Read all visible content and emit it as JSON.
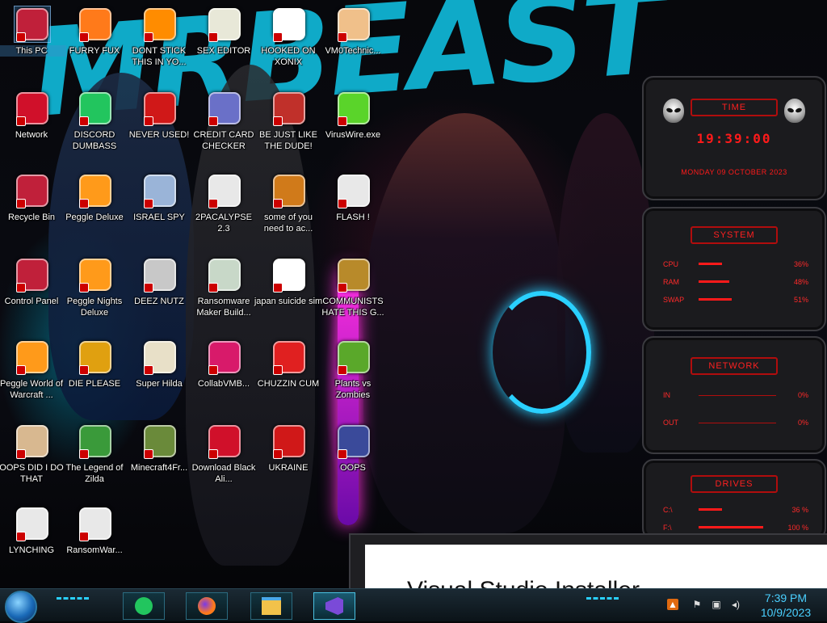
{
  "desktop": {
    "wallpaper_text": "MRBEAST",
    "icons": [
      {
        "label": "This PC",
        "icon": "computer-icon",
        "color": "#c0203a"
      },
      {
        "label": "FURRY FUX",
        "icon": "firefox-icon",
        "color": "#ff7a1a"
      },
      {
        "label": "DONT STICK THIS IN YO...",
        "icon": "vlc-cone-icon",
        "color": "#ff8c00"
      },
      {
        "label": "SEX EDITOR",
        "icon": "hxd-editor-icon",
        "color": "#e8e8d8"
      },
      {
        "label": "HOOKED ON XONIX",
        "icon": "xonix-game-icon",
        "color": "#ffffff"
      },
      {
        "label": "VM0Technic...",
        "icon": "doctor-avatar-icon",
        "color": "#f0c08a"
      },
      {
        "label": "Network",
        "icon": "network-orb-icon",
        "color": "#d0102a"
      },
      {
        "label": "DISCORD DUMBASS",
        "icon": "chat-app-icon",
        "color": "#22c55e"
      },
      {
        "label": "NEVER USED!",
        "icon": "dev-cpp-icon",
        "color": "#d01818"
      },
      {
        "label": "CREDIT CARD CHECKER",
        "icon": "credit-card-icon",
        "color": "#6a70c8"
      },
      {
        "label": "BE JUST LIKE THE DUDE!",
        "icon": "santa-bonzi-icon",
        "color": "#c0302a"
      },
      {
        "label": "VirusWire.exe",
        "icon": "lime-wire-icon",
        "color": "#5ad42a"
      },
      {
        "label": "Recycle Bin",
        "icon": "recycle-bin-icon",
        "color": "#c0203a"
      },
      {
        "label": "Peggle Deluxe",
        "icon": "peggle-icon",
        "color": "#ff9a1a"
      },
      {
        "label": "ISRAEL SPY",
        "icon": "spy-window-icon",
        "color": "#9ab4d8"
      },
      {
        "label": "2PACALYPSE 2.3",
        "icon": "terminal-icon",
        "color": "#e8e8e8"
      },
      {
        "label": "some of you need to ac...",
        "icon": "beaver-icon",
        "color": "#d07a1a"
      },
      {
        "label": "FLASH !",
        "icon": "flash-document-icon",
        "color": "#e8e8e8"
      },
      {
        "label": "Control Panel",
        "icon": "control-panel-icon",
        "color": "#c0203a"
      },
      {
        "label": "Peggle Nights Deluxe",
        "icon": "peggle-nights-icon",
        "color": "#ff9a1a"
      },
      {
        "label": "DEEZ NUTZ",
        "icon": "stacked-windows-icon",
        "color": "#c8c8c8"
      },
      {
        "label": "Ransomware Maker Build...",
        "icon": "builder-window-icon",
        "color": "#c8d8c8"
      },
      {
        "label": "japan suicide sim",
        "icon": "text-document-icon",
        "color": "#ffffff"
      },
      {
        "label": "COMMUNISTS HATE THIS G...",
        "icon": "money-bag-icon",
        "color": "#b88a2a"
      },
      {
        "label": "Peggle World of Warcraft ...",
        "icon": "peggle-wow-icon",
        "color": "#ff9a1a"
      },
      {
        "label": "DIE PLEASE",
        "icon": "de-box-icon",
        "color": "#e0a010"
      },
      {
        "label": "Super Hilda",
        "icon": "pixel-art-icon",
        "color": "#e8e0c8"
      },
      {
        "label": "CollabVMB...",
        "icon": "monitor-icon",
        "color": "#d81a6a"
      },
      {
        "label": "CHUZZIN CUM",
        "icon": "chuzzle-icon",
        "color": "#e02020"
      },
      {
        "label": "Plants vs Zombies",
        "icon": "plant-icon",
        "color": "#5aa82a"
      },
      {
        "label": "OOPS DID I DO THAT",
        "icon": "portrait-icon",
        "color": "#d8b890"
      },
      {
        "label": "The Legend of Zilda",
        "icon": "pixel-hero-icon",
        "color": "#3a9a3a"
      },
      {
        "label": "Minecraft4Fr...",
        "icon": "grass-block-icon",
        "color": "#6a8a3a"
      },
      {
        "label": "Download Black Ali...",
        "icon": "black-alien-orb-icon",
        "color": "#d0102a"
      },
      {
        "label": "UKRAINE",
        "icon": "radiation-icon",
        "color": "#d01818"
      },
      {
        "label": "OOPS",
        "icon": "book-monitor-icon",
        "color": "#3a4a9a"
      },
      {
        "label": "LYNCHING",
        "icon": "noose-icon",
        "color": "#e8e8e8"
      },
      {
        "label": "RansomWar...",
        "icon": "skull-icon",
        "color": "#e8e8e8"
      }
    ]
  },
  "gadget": {
    "time_title": "TIME",
    "time": "19:39:00",
    "date": "MONDAY 09 OCTOBER 2023",
    "system_title": "SYSTEM",
    "system_rows": [
      {
        "label": "CPU",
        "value": "36%",
        "level": 0.36
      },
      {
        "label": "RAM",
        "value": "48%",
        "level": 0.48
      },
      {
        "label": "SWAP",
        "value": "51%",
        "level": 0.51
      }
    ],
    "network_title": "NETWORK",
    "network_rows": [
      {
        "label": "IN",
        "value": "0%"
      },
      {
        "label": "OUT",
        "value": "0%"
      }
    ],
    "drives_title": "DRIVES",
    "drives_rows": [
      {
        "label": "C:\\",
        "value": "36 %",
        "level": 0.36
      },
      {
        "label": "F:\\",
        "value": "100 %",
        "level": 1.0
      }
    ],
    "accent": "#ff1a1a"
  },
  "window": {
    "title": "Visual Studio Installer"
  },
  "taskbar": {
    "pinned": [
      "chat-app-icon",
      "firefox-icon",
      "file-explorer-icon",
      "visual-studio-installer-icon"
    ],
    "tray": [
      "app-tray-icon",
      "flag-icon",
      "network-icon",
      "volume-icon"
    ],
    "time": "7:39 PM",
    "date": "10/9/2023"
  }
}
